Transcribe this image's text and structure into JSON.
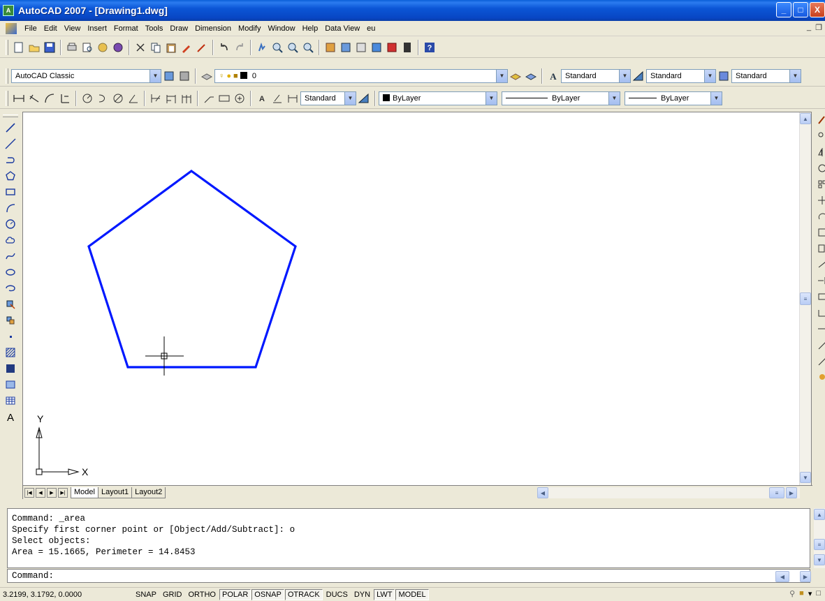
{
  "window": {
    "title": "AutoCAD 2007 - [Drawing1.dwg]",
    "min": "_",
    "max": "□",
    "close": "X"
  },
  "menu": [
    "File",
    "Edit",
    "View",
    "Insert",
    "Format",
    "Tools",
    "Draw",
    "Dimension",
    "Modify",
    "Window",
    "Help",
    "Data View",
    "eu"
  ],
  "toolbars": {
    "workspace": "AutoCAD Classic",
    "layer": "0",
    "text_style": "Standard",
    "dim_style": "Standard",
    "table_style": "Standard",
    "dim_style2": "Standard",
    "color": "ByLayer",
    "linetype": "ByLayer",
    "lineweight": "ByLayer"
  },
  "drawing": {
    "axis_x": "X",
    "axis_y": "Y",
    "tabs": [
      "Model",
      "Layout1",
      "Layout2"
    ],
    "active_tab": "Model",
    "pentagon_color": "#0018ff"
  },
  "command_history": [
    "Command: _area",
    "Specify first corner point or [Object/Add/Subtract]: o",
    "Select objects:",
    "Area = 15.1665, Perimeter = 14.8453"
  ],
  "command_prompt": "Command:",
  "status": {
    "coords": "3.2199, 3.1792, 0.0000",
    "buttons": [
      {
        "label": "SNAP",
        "on": false
      },
      {
        "label": "GRID",
        "on": false
      },
      {
        "label": "ORTHO",
        "on": false
      },
      {
        "label": "POLAR",
        "on": true
      },
      {
        "label": "OSNAP",
        "on": true
      },
      {
        "label": "OTRACK",
        "on": true
      },
      {
        "label": "DUCS",
        "on": false
      },
      {
        "label": "DYN",
        "on": false
      },
      {
        "label": "LWT",
        "on": true
      },
      {
        "label": "MODEL",
        "on": true
      }
    ]
  }
}
